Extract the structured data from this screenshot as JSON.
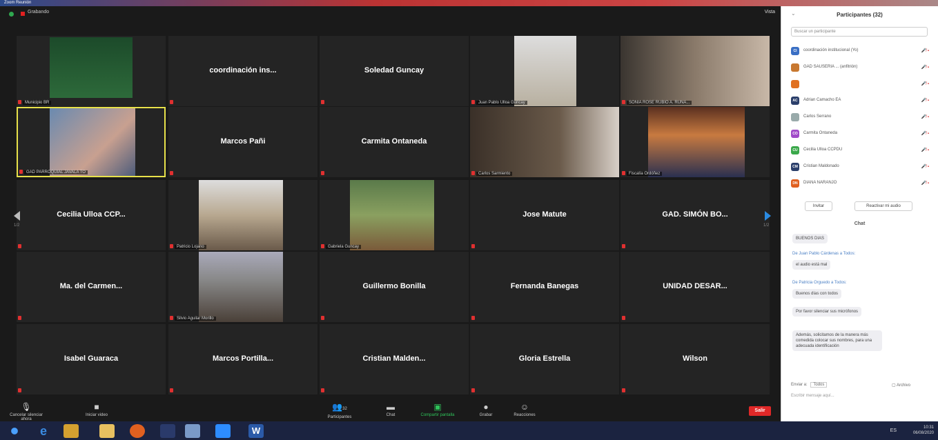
{
  "window": {
    "title": "Zoom Reunión"
  },
  "topbar": {
    "recording": "Grabando",
    "view": "Vista"
  },
  "tiles": [
    {
      "name": "",
      "label": "Municipio BR"
    },
    {
      "name": "coordinación ins...",
      "label": ""
    },
    {
      "name": "Soledad Guncay",
      "label": ""
    },
    {
      "name": "",
      "label": "Juan Pablo Ulloa Guncay"
    },
    {
      "name": "",
      "label": "SONIA ROSE RUBIO A. RUNA..."
    },
    {
      "name": "",
      "label": "GAD PARROQUIAL JAVALA TO"
    },
    {
      "name": "Marcos Pañi",
      "label": ""
    },
    {
      "name": "Carmita Ontaneda",
      "label": ""
    },
    {
      "name": "",
      "label": "Carlos Sarmiento"
    },
    {
      "name": "",
      "label": "Fiscalía Ordóñez"
    },
    {
      "name": "Cecilia Ulloa CCP...",
      "label": ""
    },
    {
      "name": "",
      "label": "Patricio Lojano"
    },
    {
      "name": "",
      "label": "Gabriela Guncay"
    },
    {
      "name": "Jose Matute",
      "label": ""
    },
    {
      "name": "GAD. SIMÓN BO...",
      "label": ""
    },
    {
      "name": "Ma. del Carmen...",
      "label": ""
    },
    {
      "name": "",
      "label": "Silvio Aguilar Morillo"
    },
    {
      "name": "Guillermo Bonilla",
      "label": ""
    },
    {
      "name": "Fernanda Banegas",
      "label": ""
    },
    {
      "name": "UNIDAD DESAR...",
      "label": ""
    },
    {
      "name": "Isabel Guaraca",
      "label": ""
    },
    {
      "name": "Marcos Portilla...",
      "label": ""
    },
    {
      "name": "Cristian Malden...",
      "label": ""
    },
    {
      "name": "Gloria Estrella",
      "label": ""
    },
    {
      "name": "Wilson",
      "label": ""
    }
  ],
  "pager": {
    "left": "1/2",
    "right": "1/2"
  },
  "toolbar": {
    "mute": "Cancelar silenciar ahora",
    "video": "Iniciar video",
    "participants": "Participantes",
    "participants_count": "32",
    "chat": "Chat",
    "share": "Compartir pantalla",
    "record": "Grabar",
    "reactions": "Reacciones",
    "leave": "Salir"
  },
  "panel": {
    "title": "Participantes (32)",
    "search_placeholder": "Buscar un participante",
    "participants": [
      {
        "initials": "CI",
        "name": "coordinación institucional (Yo)",
        "color": "#3a6fc4"
      },
      {
        "initials": "",
        "name": "GAD SAUSERIA ... (anfitrión)",
        "color": "#c87830"
      },
      {
        "initials": "",
        "name": "",
        "color": "#e07020"
      },
      {
        "initials": "AC",
        "name": "Adrian Camacho EA",
        "color": "#2b3f6b"
      },
      {
        "initials": "",
        "name": "Carlos Serrano",
        "color": "#9aa"
      },
      {
        "initials": "CO",
        "name": "Carmita Ontaneda",
        "color": "#a04ac8"
      },
      {
        "initials": "CU",
        "name": "Cecilia Ulloa CCPDU",
        "color": "#3aa84a"
      },
      {
        "initials": "CM",
        "name": "Cristian Maldonado",
        "color": "#2b3f6b"
      },
      {
        "initials": "DN",
        "name": "DIANA NARANJO",
        "color": "#e06020"
      }
    ],
    "invite": "Invitar",
    "unmute_all": "Reactivar mi audio",
    "chat_title": "Chat",
    "chat": [
      {
        "from": "",
        "text": "BUENOS DIAS"
      },
      {
        "from": "De Juan Pablo Cárdenas a Todos:",
        "text": "el audio está mal"
      },
      {
        "from": "De Patricia Orguedo a Todos:",
        "text": "Buenos días con todos"
      },
      {
        "from": "",
        "text": "Por favor silenciar sus micrófonos"
      },
      {
        "from": "",
        "text": "Además, solicitamos de la manera más comedida colocar sus nombres, para una adecuada identificación"
      }
    ],
    "send_to_label": "Enviar a:",
    "send_to_value": "Todos",
    "file": "Archivo",
    "chat_placeholder": "Escribir mensaje aquí..."
  },
  "taskbar": {
    "tray": "ES",
    "time": "10:31",
    "date": "06/08/2020"
  }
}
